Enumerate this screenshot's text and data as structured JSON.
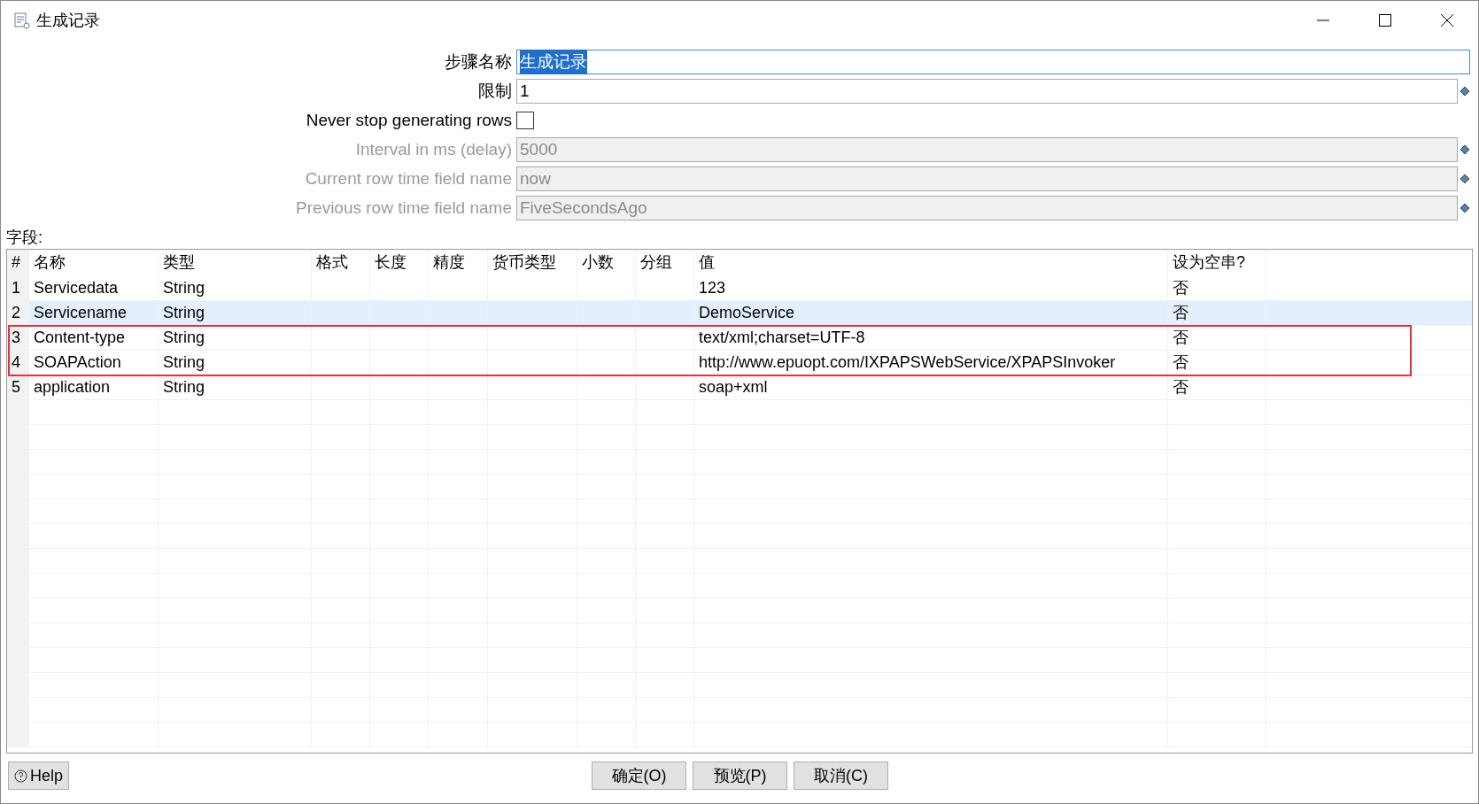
{
  "window": {
    "title": "生成记录"
  },
  "form": [
    {
      "kind": "text",
      "label": "步骤名称",
      "value": "生成记录",
      "disabled": false,
      "focused": true
    },
    {
      "kind": "variable",
      "label": "限制",
      "value": "1",
      "disabled": false,
      "focused": false
    },
    {
      "kind": "checkbox",
      "label": "Never stop generating rows",
      "checked": false
    },
    {
      "kind": "variable",
      "label": "Interval in ms (delay)",
      "value": "5000",
      "disabled": true,
      "focused": false
    },
    {
      "kind": "variable",
      "label": "Current row time field name",
      "value": "now",
      "disabled": true,
      "focused": false
    },
    {
      "kind": "variable",
      "label": "Previous row time field name",
      "value": "FiveSecondsAgo",
      "disabled": true,
      "focused": false
    }
  ],
  "fields_label": "字段:",
  "table": {
    "columns": [
      "#",
      "名称",
      "类型",
      "格式",
      "长度",
      "精度",
      "货币类型",
      "小数",
      "分组",
      "值",
      "设为空串?"
    ],
    "rows": [
      {
        "cells": [
          "1",
          "Servicedata",
          "String",
          "",
          "",
          "",
          "",
          "",
          "",
          "123",
          "否"
        ],
        "selected": false,
        "marked": false
      },
      {
        "cells": [
          "2",
          "Servicename",
          "String",
          "",
          "",
          "",
          "",
          "",
          "",
          "DemoService",
          "否"
        ],
        "selected": true,
        "marked": false
      },
      {
        "cells": [
          "3",
          "Content-type",
          "String",
          "",
          "",
          "",
          "",
          "",
          "",
          "text/xml;charset=UTF-8",
          "否"
        ],
        "selected": false,
        "marked": true
      },
      {
        "cells": [
          "4",
          "SOAPAction",
          "String",
          "",
          "",
          "",
          "",
          "",
          "",
          "http://www.epuopt.com/IXPAPSWebService/XPAPSInvoker",
          "否"
        ],
        "selected": false,
        "marked": true
      },
      {
        "cells": [
          "5",
          "application",
          "String",
          "",
          "",
          "",
          "",
          "",
          "",
          "soap+xml",
          "否"
        ],
        "selected": false,
        "marked": false
      }
    ]
  },
  "buttons": {
    "help": "Help",
    "actions": [
      "确定(O)",
      "预览(P)",
      "取消(C)"
    ]
  }
}
